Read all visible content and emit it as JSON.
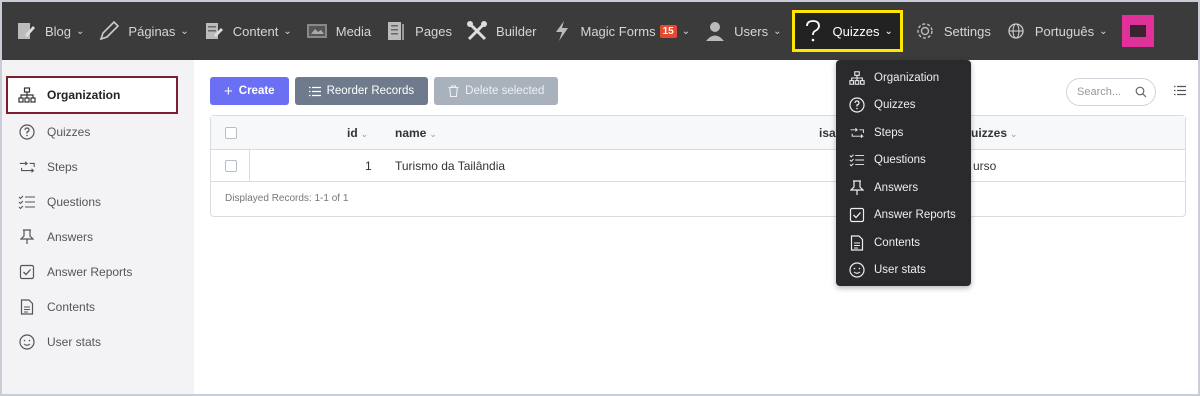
{
  "topnav": {
    "items": [
      {
        "label": "Blog",
        "icon": "blog-icon",
        "has_dropdown": true
      },
      {
        "label": "Páginas",
        "icon": "pencil-icon",
        "has_dropdown": true
      },
      {
        "label": "Content",
        "icon": "content-icon",
        "has_dropdown": true
      },
      {
        "label": "Media",
        "icon": "media-icon",
        "has_dropdown": false
      },
      {
        "label": "Pages",
        "icon": "pages-icon",
        "has_dropdown": false
      },
      {
        "label": "Builder",
        "icon": "tools-icon",
        "has_dropdown": false
      },
      {
        "label": "Magic Forms",
        "icon": "lightning-icon",
        "badge": "15",
        "has_dropdown": true
      },
      {
        "label": "Users",
        "icon": "user-icon",
        "has_dropdown": true
      },
      {
        "label": "Quizzes",
        "icon": "question-icon",
        "has_dropdown": true,
        "active": true
      },
      {
        "label": "Settings",
        "icon": "gear-icon",
        "has_dropdown": false
      },
      {
        "label": "Português",
        "icon": "globe-icon",
        "has_dropdown": true
      }
    ],
    "highlight_color": "#ffe600",
    "badge_color": "#e64a2e"
  },
  "sidebar": {
    "items": [
      {
        "label": "Organization",
        "icon": "sitemap-icon",
        "active": true
      },
      {
        "label": "Quizzes",
        "icon": "question-circle-icon"
      },
      {
        "label": "Steps",
        "icon": "steps-icon"
      },
      {
        "label": "Questions",
        "icon": "checklist-icon"
      },
      {
        "label": "Answers",
        "icon": "pin-icon"
      },
      {
        "label": "Answer Reports",
        "icon": "checkbox-icon"
      },
      {
        "label": "Contents",
        "icon": "document-icon"
      },
      {
        "label": "User stats",
        "icon": "smiley-icon"
      }
    ]
  },
  "toolbar": {
    "create_label": "Create",
    "reorder_label": "Reorder Records",
    "delete_label": "Delete selected",
    "primary_color": "#6a6ff3"
  },
  "search": {
    "placeholder": "Search..."
  },
  "table": {
    "columns": [
      {
        "label": "id"
      },
      {
        "label": "name"
      },
      {
        "label": "isac"
      },
      {
        "label": "uizzes"
      }
    ],
    "rows": [
      {
        "id": "1",
        "name": "Turismo da Tailândia",
        "col4": "urso"
      }
    ],
    "footer": "Displayed Records: 1-1 of 1"
  },
  "dropdown": {
    "items": [
      {
        "label": "Organization",
        "icon": "sitemap-icon"
      },
      {
        "label": "Quizzes",
        "icon": "question-circle-icon"
      },
      {
        "label": "Steps",
        "icon": "steps-icon"
      },
      {
        "label": "Questions",
        "icon": "checklist-icon"
      },
      {
        "label": "Answers",
        "icon": "pin-icon"
      },
      {
        "label": "Answer Reports",
        "icon": "checkbox-icon"
      },
      {
        "label": "Contents",
        "icon": "document-icon"
      },
      {
        "label": "User stats",
        "icon": "smiley-icon"
      }
    ]
  }
}
